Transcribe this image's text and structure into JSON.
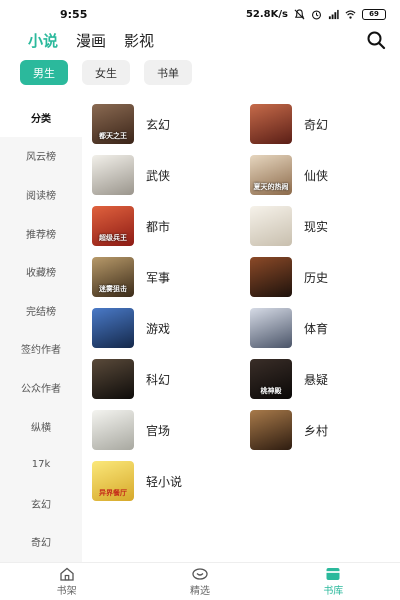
{
  "status": {
    "time": "9:55",
    "net_speed": "52.8K/s",
    "battery": "69",
    "icons": [
      "mute-icon",
      "alarm-icon",
      "signal-icon",
      "wifi-icon",
      "battery-icon"
    ]
  },
  "top_tabs": [
    {
      "label": "小说",
      "active": true
    },
    {
      "label": "漫画",
      "active": false
    },
    {
      "label": "影视",
      "active": false
    }
  ],
  "sub_tabs": [
    {
      "label": "男生",
      "active": true
    },
    {
      "label": "女生",
      "active": false
    },
    {
      "label": "书单",
      "active": false
    }
  ],
  "sidebar": [
    {
      "label": "分类",
      "active": true
    },
    {
      "label": "风云榜"
    },
    {
      "label": "阅读榜"
    },
    {
      "label": "推荐榜"
    },
    {
      "label": "收藏榜"
    },
    {
      "label": "完结榜"
    },
    {
      "label": "签约作者"
    },
    {
      "label": "公众作者"
    },
    {
      "label": "纵横"
    },
    {
      "label": "17k"
    },
    {
      "label": "玄幻"
    },
    {
      "label": "奇幻"
    }
  ],
  "categories": [
    {
      "label": "玄幻",
      "cover_text": "都天之王",
      "color": "#6b4a3a"
    },
    {
      "label": "奇幻",
      "cover_text": "",
      "color": "#8a3b2e"
    },
    {
      "label": "武侠",
      "cover_text": "",
      "color": "#d9d4c8"
    },
    {
      "label": "仙侠",
      "cover_text": "夏天的热闹",
      "color": "#c9b79e"
    },
    {
      "label": "都市",
      "cover_text": "超级兵王",
      "color": "#c2352a"
    },
    {
      "label": "现实",
      "cover_text": "",
      "color": "#e8e2d6"
    },
    {
      "label": "军事",
      "cover_text": "迷雾狙击",
      "color": "#6e5a3c"
    },
    {
      "label": "历史",
      "cover_text": "",
      "color": "#4a2c1e"
    },
    {
      "label": "游戏",
      "cover_text": "",
      "color": "#2b4f8a"
    },
    {
      "label": "体育",
      "cover_text": "",
      "color": "#8c95a6"
    },
    {
      "label": "科幻",
      "cover_text": "",
      "color": "#2d2a28"
    },
    {
      "label": "悬疑",
      "cover_text": "桃神殿",
      "color": "#1f1a18"
    },
    {
      "label": "官场",
      "cover_text": "",
      "color": "#dcdcd6"
    },
    {
      "label": "乡村",
      "cover_text": "",
      "color": "#5c3e28"
    },
    {
      "label": "轻小说",
      "cover_text": "异界餐厅",
      "color": "#f2dc5a"
    }
  ],
  "bottom_nav": [
    {
      "label": "书架",
      "icon": "home-icon",
      "active": false
    },
    {
      "label": "精选",
      "icon": "eye-icon",
      "active": false
    },
    {
      "label": "书库",
      "icon": "library-icon",
      "active": true
    }
  ],
  "colors": {
    "accent": "#2bb99c",
    "sidebar_bg": "#f6f6f6"
  }
}
